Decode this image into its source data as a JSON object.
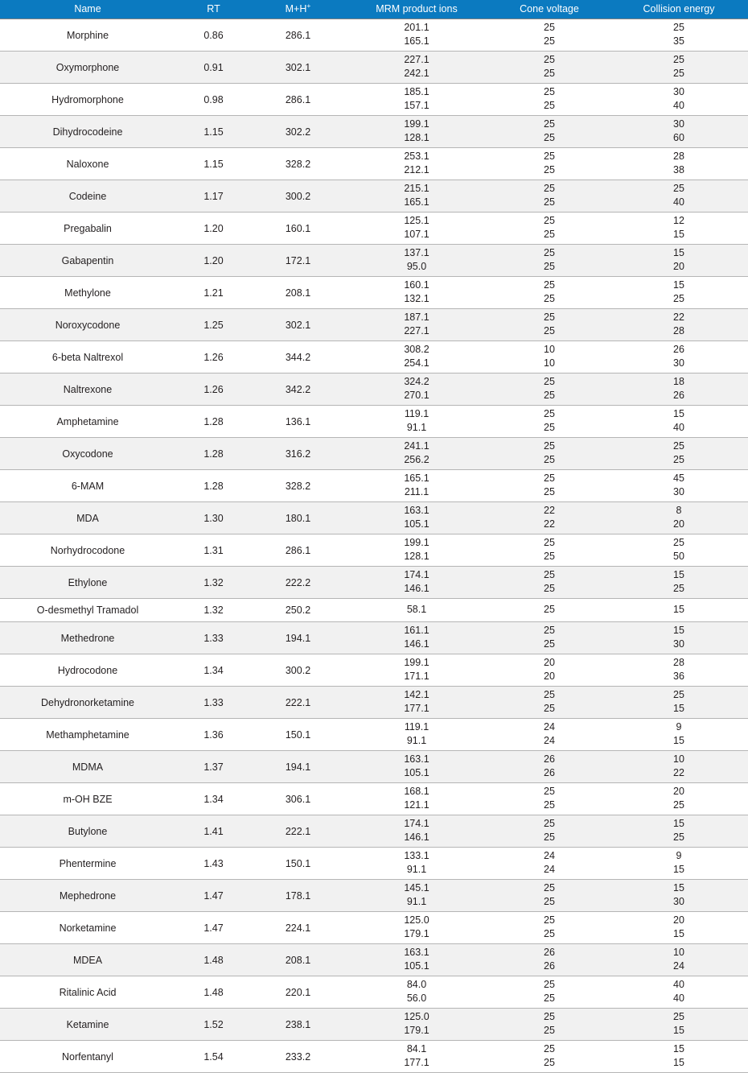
{
  "table": {
    "name": "mrm-transition-table",
    "header_background": "#0b7ac0",
    "header_text_color": "#ffffff",
    "row_alt_background": "#f1f1f1",
    "columns": [
      {
        "key": "name",
        "label": "Name"
      },
      {
        "key": "rt",
        "label": "RT"
      },
      {
        "key": "mh",
        "label": "M+H",
        "superscript": "+"
      },
      {
        "key": "mrm",
        "label": "MRM product ions"
      },
      {
        "key": "cone",
        "label": "Cone voltage"
      },
      {
        "key": "collision",
        "label": "Collision energy"
      }
    ],
    "rows": [
      {
        "name": "Morphine",
        "rt": "0.86",
        "mh": "286.1",
        "mrm": [
          "201.1",
          "165.1"
        ],
        "cone": [
          "25",
          "25"
        ],
        "collision": [
          "25",
          "35"
        ]
      },
      {
        "name": "Oxymorphone",
        "rt": "0.91",
        "mh": "302.1",
        "mrm": [
          "227.1",
          "242.1"
        ],
        "cone": [
          "25",
          "25"
        ],
        "collision": [
          "25",
          "25"
        ]
      },
      {
        "name": "Hydromorphone",
        "rt": "0.98",
        "mh": "286.1",
        "mrm": [
          "185.1",
          "157.1"
        ],
        "cone": [
          "25",
          "25"
        ],
        "collision": [
          "30",
          "40"
        ]
      },
      {
        "name": "Dihydrocodeine",
        "rt": "1.15",
        "mh": "302.2",
        "mrm": [
          "199.1",
          "128.1"
        ],
        "cone": [
          "25",
          "25"
        ],
        "collision": [
          "30",
          "60"
        ]
      },
      {
        "name": "Naloxone",
        "rt": "1.15",
        "mh": "328.2",
        "mrm": [
          "253.1",
          "212.1"
        ],
        "cone": [
          "25",
          "25"
        ],
        "collision": [
          "28",
          "38"
        ]
      },
      {
        "name": "Codeine",
        "rt": "1.17",
        "mh": "300.2",
        "mrm": [
          "215.1",
          "165.1"
        ],
        "cone": [
          "25",
          "25"
        ],
        "collision": [
          "25",
          "40"
        ]
      },
      {
        "name": "Pregabalin",
        "rt": "1.20",
        "mh": "160.1",
        "mrm": [
          "125.1",
          "107.1"
        ],
        "cone": [
          "25",
          "25"
        ],
        "collision": [
          "12",
          "15"
        ]
      },
      {
        "name": "Gabapentin",
        "rt": "1.20",
        "mh": "172.1",
        "mrm": [
          "137.1",
          "95.0"
        ],
        "cone": [
          "25",
          "25"
        ],
        "collision": [
          "15",
          "20"
        ]
      },
      {
        "name": "Methylone",
        "rt": "1.21",
        "mh": "208.1",
        "mrm": [
          "160.1",
          "132.1"
        ],
        "cone": [
          "25",
          "25"
        ],
        "collision": [
          "15",
          "25"
        ]
      },
      {
        "name": "Noroxycodone",
        "rt": "1.25",
        "mh": "302.1",
        "mrm": [
          "187.1",
          "227.1"
        ],
        "cone": [
          "25",
          "25"
        ],
        "collision": [
          "22",
          "28"
        ]
      },
      {
        "name": "6-beta Naltrexol",
        "rt": "1.26",
        "mh": "344.2",
        "mrm": [
          "308.2",
          "254.1"
        ],
        "cone": [
          "10",
          "10"
        ],
        "collision": [
          "26",
          "30"
        ]
      },
      {
        "name": "Naltrexone",
        "rt": "1.26",
        "mh": "342.2",
        "mrm": [
          "324.2",
          "270.1"
        ],
        "cone": [
          "25",
          "25"
        ],
        "collision": [
          "18",
          "26"
        ]
      },
      {
        "name": "Amphetamine",
        "rt": "1.28",
        "mh": "136.1",
        "mrm": [
          "119.1",
          "91.1"
        ],
        "cone": [
          "25",
          "25"
        ],
        "collision": [
          "15",
          "40"
        ]
      },
      {
        "name": "Oxycodone",
        "rt": "1.28",
        "mh": "316.2",
        "mrm": [
          "241.1",
          "256.2"
        ],
        "cone": [
          "25",
          "25"
        ],
        "collision": [
          "25",
          "25"
        ]
      },
      {
        "name": "6-MAM",
        "rt": "1.28",
        "mh": "328.2",
        "mrm": [
          "165.1",
          "211.1"
        ],
        "cone": [
          "25",
          "25"
        ],
        "collision": [
          "45",
          "30"
        ]
      },
      {
        "name": "MDA",
        "rt": "1.30",
        "mh": "180.1",
        "mrm": [
          "163.1",
          "105.1"
        ],
        "cone": [
          "22",
          "22"
        ],
        "collision": [
          "8",
          "20"
        ]
      },
      {
        "name": "Norhydrocodone",
        "rt": "1.31",
        "mh": "286.1",
        "mrm": [
          "199.1",
          "128.1"
        ],
        "cone": [
          "25",
          "25"
        ],
        "collision": [
          "25",
          "50"
        ]
      },
      {
        "name": "Ethylone",
        "rt": "1.32",
        "mh": "222.2",
        "mrm": [
          "174.1",
          "146.1"
        ],
        "cone": [
          "25",
          "25"
        ],
        "collision": [
          "15",
          "25"
        ]
      },
      {
        "name": "O-desmethyl Tramadol",
        "rt": "1.32",
        "mh": "250.2",
        "mrm": [
          "58.1"
        ],
        "cone": [
          "25"
        ],
        "collision": [
          "15"
        ]
      },
      {
        "name": "Methedrone",
        "rt": "1.33",
        "mh": "194.1",
        "mrm": [
          "161.1",
          "146.1"
        ],
        "cone": [
          "25",
          "25"
        ],
        "collision": [
          "15",
          "30"
        ]
      },
      {
        "name": "Hydrocodone",
        "rt": "1.34",
        "mh": "300.2",
        "mrm": [
          "199.1",
          "171.1"
        ],
        "cone": [
          "20",
          "20"
        ],
        "collision": [
          "28",
          "36"
        ]
      },
      {
        "name": "Dehydronorketamine",
        "rt": "1.33",
        "mh": "222.1",
        "mrm": [
          "142.1",
          "177.1"
        ],
        "cone": [
          "25",
          "25"
        ],
        "collision": [
          "25",
          "15"
        ]
      },
      {
        "name": "Methamphetamine",
        "rt": "1.36",
        "mh": "150.1",
        "mrm": [
          "119.1",
          "91.1"
        ],
        "cone": [
          "24",
          "24"
        ],
        "collision": [
          "9",
          "15"
        ]
      },
      {
        "name": "MDMA",
        "rt": "1.37",
        "mh": "194.1",
        "mrm": [
          "163.1",
          "105.1"
        ],
        "cone": [
          "26",
          "26"
        ],
        "collision": [
          "10",
          "22"
        ]
      },
      {
        "name": "m-OH BZE",
        "rt": "1.34",
        "mh": "306.1",
        "mrm": [
          "168.1",
          "121.1"
        ],
        "cone": [
          "25",
          "25"
        ],
        "collision": [
          "20",
          "25"
        ]
      },
      {
        "name": "Butylone",
        "rt": "1.41",
        "mh": "222.1",
        "mrm": [
          "174.1",
          "146.1"
        ],
        "cone": [
          "25",
          "25"
        ],
        "collision": [
          "15",
          "25"
        ]
      },
      {
        "name": "Phentermine",
        "rt": "1.43",
        "mh": "150.1",
        "mrm": [
          "133.1",
          "91.1"
        ],
        "cone": [
          "24",
          "24"
        ],
        "collision": [
          "9",
          "15"
        ]
      },
      {
        "name": "Mephedrone",
        "rt": "1.47",
        "mh": "178.1",
        "mrm": [
          "145.1",
          "91.1"
        ],
        "cone": [
          "25",
          "25"
        ],
        "collision": [
          "15",
          "30"
        ]
      },
      {
        "name": "Norketamine",
        "rt": "1.47",
        "mh": "224.1",
        "mrm": [
          "125.0",
          "179.1"
        ],
        "cone": [
          "25",
          "25"
        ],
        "collision": [
          "20",
          "15"
        ]
      },
      {
        "name": "MDEA",
        "rt": "1.48",
        "mh": "208.1",
        "mrm": [
          "163.1",
          "105.1"
        ],
        "cone": [
          "26",
          "26"
        ],
        "collision": [
          "10",
          "24"
        ]
      },
      {
        "name": "Ritalinic Acid",
        "rt": "1.48",
        "mh": "220.1",
        "mrm": [
          "84.0",
          "56.0"
        ],
        "cone": [
          "25",
          "25"
        ],
        "collision": [
          "40",
          "40"
        ]
      },
      {
        "name": "Ketamine",
        "rt": "1.52",
        "mh": "238.1",
        "mrm": [
          "125.0",
          "179.1"
        ],
        "cone": [
          "25",
          "25"
        ],
        "collision": [
          "25",
          "15"
        ]
      },
      {
        "name": "Norfentanyl",
        "rt": "1.54",
        "mh": "233.2",
        "mrm": [
          "84.1",
          "177.1"
        ],
        "cone": [
          "25",
          "25"
        ],
        "collision": [
          "15",
          "15"
        ]
      }
    ]
  }
}
